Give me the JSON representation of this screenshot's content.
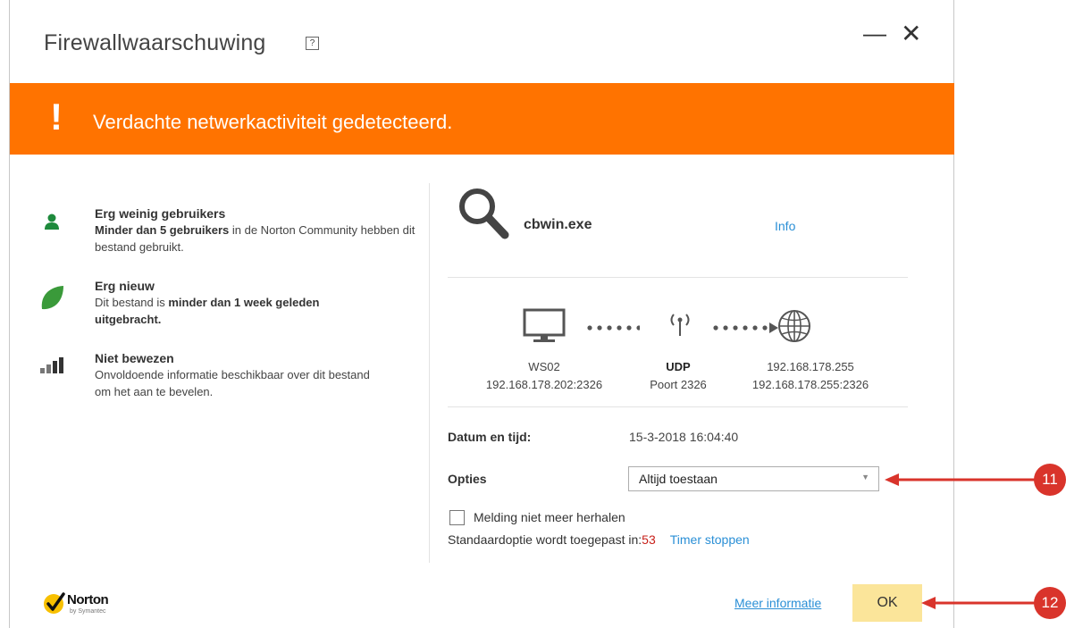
{
  "window": {
    "title": "Firewallwaarschuwing",
    "help_icon": "?",
    "minimize": "—",
    "close": "✕"
  },
  "banner": {
    "icon": "!",
    "text": "Verdachte netwerkactiviteit gedetecteerd.",
    "color": "#ff7300"
  },
  "info": [
    {
      "icon": "user-icon",
      "title": "Erg weinig gebruikers",
      "desc_bold": "Minder dan 5 gebruikers",
      "desc_rest": " in de Norton Community hebben dit bestand gebruikt."
    },
    {
      "icon": "leaf-icon",
      "title": "Erg nieuw",
      "desc_pre": "Dit bestand is ",
      "desc_bold": "minder dan 1 week geleden uitgebracht."
    },
    {
      "icon": "signal-bars-icon",
      "title": "Niet bewezen",
      "desc": "Onvoldoende informatie beschikbaar over dit bestand om het aan te bevelen."
    }
  ],
  "file": {
    "name": "cbwin.exe",
    "info_link": "Info"
  },
  "connection": {
    "source_name": "WS02",
    "source_addr": "192.168.178.202:2326",
    "protocol": "UDP",
    "port": "Poort 2326",
    "dest_name": "192.168.178.255",
    "dest_addr": "192.168.178.255:2326"
  },
  "datetime": {
    "label": "Datum en tijd:",
    "value": "15-3-2018 16:04:40"
  },
  "options": {
    "label": "Opties",
    "selected": "Altijd toestaan"
  },
  "checkbox_label": "Melding niet meer herhalen",
  "timer": {
    "text": "Standaardoptie wordt toegepast in:",
    "count": "53",
    "stop_link": "Timer stoppen"
  },
  "footer": {
    "logo": "Norton",
    "logo_sub": "by Symantec",
    "more_info": "Meer informatie",
    "ok": "OK"
  },
  "callouts": [
    "11",
    "12"
  ],
  "colors": {
    "accent": "#ff7300",
    "link": "#2a8fd6",
    "ok_button": "#fbe59a",
    "callout": "#d9342b",
    "user_icon": "#1e8a3c",
    "leaf_icon": "#3a9a3a"
  }
}
